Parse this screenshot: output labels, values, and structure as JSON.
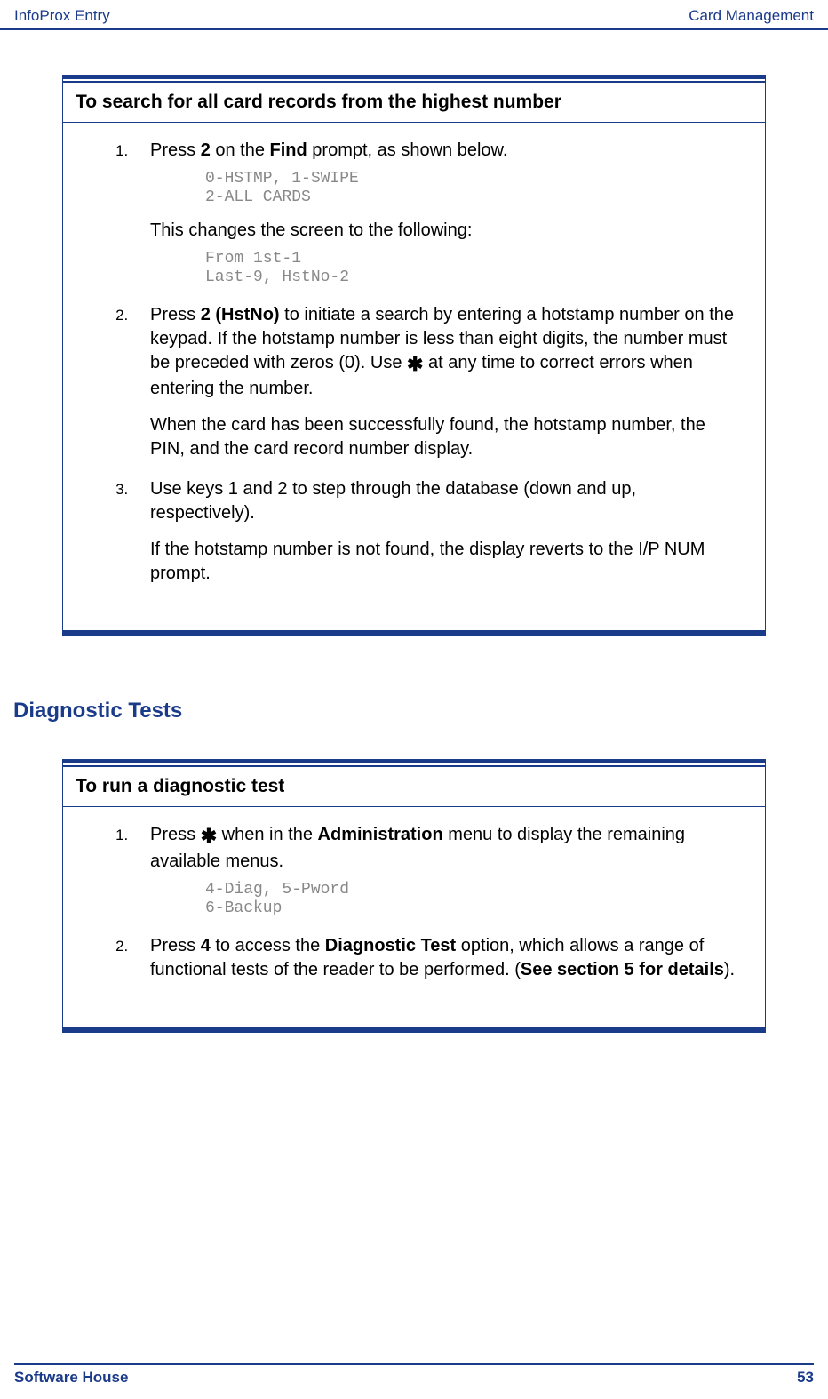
{
  "header": {
    "left": "InfoProx Entry",
    "right": "Card Management"
  },
  "footer": {
    "left": "Software House",
    "right": "53"
  },
  "box1": {
    "title": "To search for all card records from the highest number",
    "item1_a": "Press ",
    "item1_b": "2",
    "item1_c": " on the ",
    "item1_d": "Find",
    "item1_e": " prompt, as shown below.",
    "code1": "0-HSTMP, 1-SWIPE\n2-ALL CARDS",
    "item1_f": "This changes the screen to the following:",
    "code2": "From 1st-1\nLast-9, HstNo-2",
    "item2_a": "Press ",
    "item2_b": "2 (HstNo)",
    "item2_c": " to initiate a search by entering a hotstamp number on the keypad. If the hotstamp number is less than eight digits, the number must be preceded with zeros (0). Use ",
    "item2_d": " at any time to correct errors when entering the number.",
    "item2_e": "When the card has been successfully found, the hotstamp number, the PIN, and the card record number display.",
    "item3_a": "Use keys 1 and 2 to step through the database (down and up, respectively).",
    "item3_b": "If the hotstamp number is not found, the display reverts to the I/P NUM prompt."
  },
  "section_heading": "Diagnostic Tests",
  "box2": {
    "title": "To run a diagnostic test",
    "item1_a": "Press ",
    "item1_b": " when in the ",
    "item1_c": "Administration",
    "item1_d": " menu to display the remaining available menus.",
    "code1": "4-Diag, 5-Pword\n6-Backup",
    "item2_a": "Press ",
    "item2_b": "4",
    "item2_c": " to access the ",
    "item2_d": "Diagnostic Test",
    "item2_e": " option, which allows a range of functional tests of the reader to be performed. (",
    "item2_f": "See section 5 for details",
    "item2_g": ")."
  }
}
